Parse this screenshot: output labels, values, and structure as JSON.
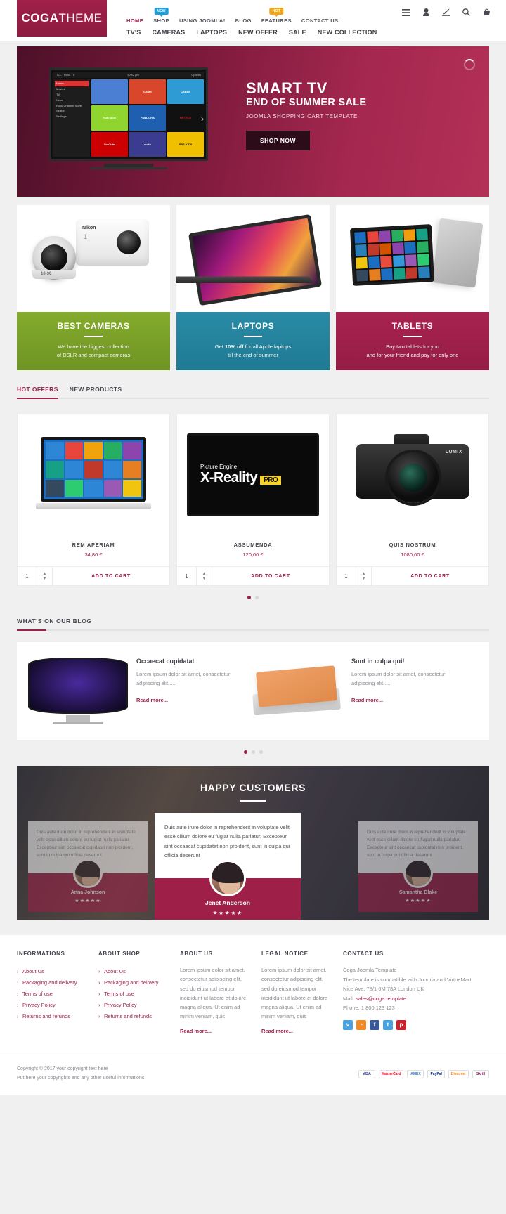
{
  "header": {
    "logo_bold": "COGA",
    "logo_light": "THEME",
    "topnav": [
      {
        "label": "HOME",
        "active": true,
        "badge": null
      },
      {
        "label": "SHOP",
        "active": false,
        "badge": "NEW",
        "badge_type": "new"
      },
      {
        "label": "USING JOOMLA!",
        "active": false,
        "badge": null
      },
      {
        "label": "BLOG",
        "active": false,
        "badge": null
      },
      {
        "label": "FEATURES",
        "active": false,
        "badge": "HOT",
        "badge_type": "hot"
      },
      {
        "label": "CONTACT US",
        "active": false,
        "badge": null
      }
    ],
    "subnav": [
      "TV'S",
      "CAMERAS",
      "LAPTOPS",
      "NEW OFFER",
      "SALE",
      "NEW COLLECTION"
    ],
    "icons": [
      "menu-icon",
      "user-icon",
      "pencil-icon",
      "search-icon",
      "cart-icon"
    ]
  },
  "hero": {
    "title": "SMART TV",
    "subtitle": "END OF SUMMER SALE",
    "tagline": "JOOMLA SHOPPING CART TEMPLATE",
    "button": "SHOP NOW",
    "tv": {
      "time": "10:42 pm",
      "brandline": "TCL · Roku TV",
      "options": "Options",
      "menu": [
        "Home",
        "Movies",
        "TV",
        "News",
        "Roku Channel Store",
        "Search",
        "Settings"
      ],
      "tiles": [
        "",
        "GAME",
        "CABLE",
        "hulu plus",
        "PANDORA",
        "NETFLIX",
        "YouTube",
        "vudu",
        "PBS KIDS"
      ]
    }
  },
  "categories": [
    {
      "title": "BEST CAMERAS",
      "line1": "We have the biggest collection",
      "line2": "of DSLR and compact cameras",
      "color": "#7da32a",
      "brand": "Nikon",
      "model": "1",
      "lens_label": "10-30"
    },
    {
      "title": "LAPTOPS",
      "line1_pre": "Get ",
      "line1_bold": "10% off",
      "line1_post": " for all Apple laptops",
      "line2": "till the end of summer",
      "color": "#22819b"
    },
    {
      "title": "TABLETS",
      "line1": "Buy two tablets for you",
      "line2": "and for your friend and pay for only one",
      "color": "#9e1f47"
    }
  ],
  "product_tabs": [
    {
      "label": "HOT OFFERS",
      "active": true
    },
    {
      "label": "NEW PRODUCTS",
      "active": false
    }
  ],
  "products": [
    {
      "name": "REM APERIAM",
      "price": "34,80 €",
      "qty": "1",
      "button": "ADD TO CART"
    },
    {
      "name": "ASSUMENDA",
      "price": "120,00 €",
      "qty": "1",
      "button": "ADD TO CART",
      "screen_top": "Picture Engine",
      "screen_main": "X-Reality",
      "screen_badge": "PRO"
    },
    {
      "name": "QUIS NOSTRUM",
      "price": "1080,00 €",
      "qty": "1",
      "button": "ADD TO CART",
      "brand": "LUMIX"
    }
  ],
  "product_dots": [
    true,
    false
  ],
  "blog": {
    "heading": "WHAT'S ON OUR BLOG",
    "posts": [
      {
        "title": "Occaecat cupidatat",
        "excerpt": "Lorem ipsum dolor sit amet, consectetur adipiscing elit.....",
        "readmore": "Read more..."
      },
      {
        "title": "Sunt in culpa qui!",
        "excerpt": "Lorem ipsum dolor sit amet, consectetur adipiscing elit.....",
        "readmore": "Read more..."
      }
    ],
    "dots": [
      true,
      false,
      false
    ]
  },
  "testimonials": {
    "heading": "HAPPY CUSTOMERS",
    "main": {
      "text": "Duis aute irure dolor in reprehenderit in voluptate velit esse cillum dolore eu fugiat nulla pariatur. Excepteur sint occaecat cupidatat non proident, sunt in culpa qui officia deserunt",
      "name": "Jenet Anderson",
      "stars": "★★★★★"
    },
    "left": {
      "text": "Duis aute irure dolor in reprehenderit in voluptate velit esse cillum dolore eu fugiat nulla pariatur. Excepteur sint occaecat cupidatat non proident, sunt in culpa qui officia deserunt",
      "name": "Anna Johnson",
      "stars": "★★★★★"
    },
    "right": {
      "text": "Duis aute irure dolor in reprehenderit in voluptate velit esse cillum dolore eu fugiat nulla pariatur. Excepteur sint occaecat cupidatat non proident, sunt in culpa qui officia deserunt",
      "name": "Samantha Blake",
      "stars": "★★★★★"
    }
  },
  "footer": {
    "col1": {
      "title": "INFORMATIONS",
      "items": [
        "About Us",
        "Packaging and delivery",
        "Terms of use",
        "Privacy Policy",
        "Returns and refunds"
      ]
    },
    "col2": {
      "title": "ABOUT SHOP",
      "items": [
        "About Us",
        "Packaging and delivery",
        "Terms of use",
        "Privacy Policy",
        "Returns and refunds"
      ]
    },
    "col3": {
      "title": "ABOUT US",
      "text": "Lorem ipsum dolor sit amet, consectetur adipiscing elit, sed do eiusmod tempor incididunt ut labore et dolore magna aliqua. Ut enim ad minim veniam, quis",
      "readmore": "Read more..."
    },
    "col4": {
      "title": "LEGAL NOTICE",
      "text": "Lorem ipsum dolor sit amet, consectetur adipiscing elit, sed do eiusmod tempor incididunt ut labore et dolore magna aliqua. Ut enim ad minim veniam, quis",
      "readmore": "Read more..."
    },
    "col5": {
      "title": "CONTACT US",
      "line1": "Coga Joomla Template",
      "line2": "The template is compatible with Joomla and VirtueMart",
      "line3": "Nice Ave, 78/1 6M 78A London UK",
      "mail_label": "Mail:",
      "mail": "sales@coga.template",
      "phone": "Phone: 1 800 123 123",
      "socials": [
        {
          "name": "vimeo-icon",
          "glyph": "v",
          "color": "#4aa3df"
        },
        {
          "name": "rss-icon",
          "glyph": "◔",
          "color": "#f08a24"
        },
        {
          "name": "facebook-icon",
          "glyph": "f",
          "color": "#3b5998"
        },
        {
          "name": "twitter-icon",
          "glyph": "t",
          "color": "#4aa3df"
        },
        {
          "name": "pinterest-icon",
          "glyph": "p",
          "color": "#c8232c"
        }
      ]
    }
  },
  "bottom": {
    "copyright": "Copyright © 2017 your copyright text here",
    "note": "Put here your copyrights and any other useful informations",
    "payments": [
      "VISA",
      "MasterCard",
      "AMEX",
      "PayPal",
      "Discover",
      "Skrill"
    ]
  }
}
